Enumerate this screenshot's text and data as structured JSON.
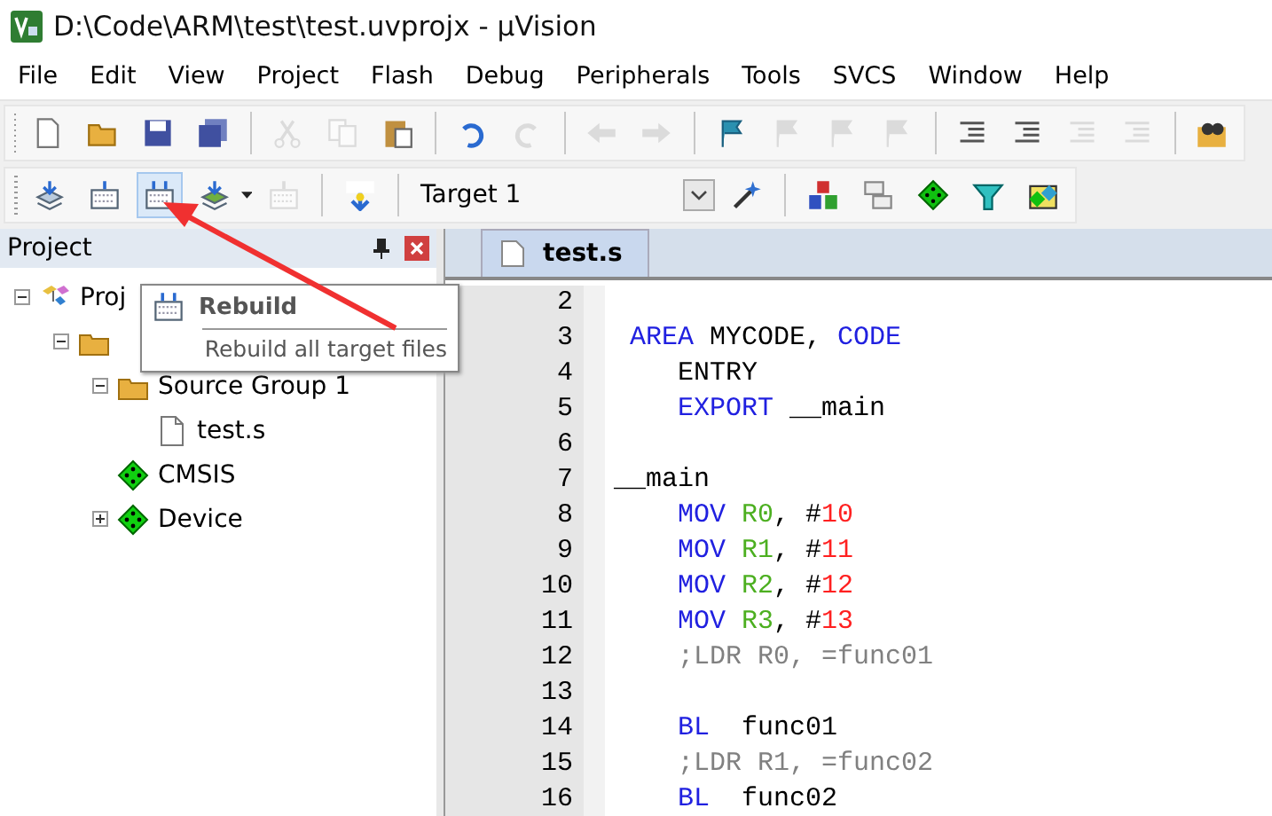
{
  "window": {
    "title": "D:\\Code\\ARM\\test\\test.uvprojx - µVision"
  },
  "menu": [
    "File",
    "Edit",
    "View",
    "Project",
    "Flash",
    "Debug",
    "Peripherals",
    "Tools",
    "SVCS",
    "Window",
    "Help"
  ],
  "toolbar": [
    {
      "kind": "new",
      "disabled": false
    },
    {
      "kind": "open",
      "disabled": false
    },
    {
      "kind": "save",
      "disabled": false
    },
    {
      "kind": "save-all",
      "disabled": false
    },
    {
      "kind": "sep"
    },
    {
      "kind": "cut",
      "disabled": true
    },
    {
      "kind": "copy",
      "disabled": true
    },
    {
      "kind": "paste",
      "disabled": false
    },
    {
      "kind": "sep"
    },
    {
      "kind": "undo",
      "disabled": false
    },
    {
      "kind": "redo",
      "disabled": true
    },
    {
      "kind": "sep"
    },
    {
      "kind": "back",
      "disabled": true
    },
    {
      "kind": "forward",
      "disabled": true
    },
    {
      "kind": "sep"
    },
    {
      "kind": "bookmark",
      "disabled": false
    },
    {
      "kind": "prev-bookmark",
      "disabled": true
    },
    {
      "kind": "next-bookmark",
      "disabled": true
    },
    {
      "kind": "clear-bookmarks",
      "disabled": true
    },
    {
      "kind": "sep"
    },
    {
      "kind": "indent",
      "disabled": false
    },
    {
      "kind": "unindent",
      "disabled": false
    },
    {
      "kind": "comment",
      "disabled": true
    },
    {
      "kind": "uncomment",
      "disabled": true
    },
    {
      "kind": "sep"
    },
    {
      "kind": "find",
      "disabled": false
    }
  ],
  "build_toolbar": {
    "buttons": [
      {
        "kind": "translate",
        "disabled": false,
        "hovered": false
      },
      {
        "kind": "build",
        "disabled": false,
        "hovered": false
      },
      {
        "kind": "rebuild",
        "disabled": false,
        "hovered": true
      },
      {
        "kind": "batch",
        "disabled": false,
        "hovered": false
      },
      {
        "kind": "stop",
        "disabled": true,
        "hovered": false
      },
      {
        "kind": "load",
        "disabled": false,
        "hovered": false
      }
    ],
    "target": "Target 1",
    "tools": [
      {
        "kind": "wand"
      },
      {
        "kind": "components"
      },
      {
        "kind": "environment"
      },
      {
        "kind": "rte"
      },
      {
        "kind": "installer"
      },
      {
        "kind": "packs"
      }
    ]
  },
  "project_panel": {
    "title": "Project",
    "tree": [
      {
        "label": "Proj",
        "kind": "project",
        "expanded": true,
        "children": [
          {
            "kind": "target",
            "expanded": true,
            "children": [
              {
                "label": "Source Group 1",
                "kind": "folder",
                "expanded": true,
                "children": [
                  {
                    "label": "test.s",
                    "kind": "file"
                  }
                ]
              },
              {
                "label": "CMSIS",
                "kind": "component"
              },
              {
                "label": "Device",
                "kind": "component",
                "expanded": false
              }
            ]
          }
        ]
      }
    ]
  },
  "tooltip": {
    "title": "Rebuild",
    "text": "Rebuild all target files"
  },
  "editor": {
    "tab": "test.s",
    "lines": [
      {
        "number": "2"
      },
      {
        "number": "3",
        "tokens": [
          {
            "kind": "keyword",
            "text": " AREA "
          },
          {
            "kind": "plain",
            "text": "MYCODE, "
          },
          {
            "kind": "keyword",
            "text": "CODE"
          }
        ]
      },
      {
        "number": "4",
        "tokens": [
          {
            "kind": "plain",
            "text": "    ENTRY"
          }
        ]
      },
      {
        "number": "5",
        "tokens": [
          {
            "kind": "keyword",
            "text": "    EXPORT "
          },
          {
            "kind": "plain",
            "text": "__main"
          }
        ]
      },
      {
        "number": "6"
      },
      {
        "number": "7",
        "tokens": [
          {
            "kind": "plain",
            "text": "__main"
          }
        ]
      },
      {
        "number": "8",
        "tokens": [
          {
            "kind": "keyword",
            "text": "    MOV "
          },
          {
            "kind": "register",
            "text": "R0"
          },
          {
            "kind": "plain",
            "text": ", #"
          },
          {
            "kind": "number",
            "text": "10"
          }
        ]
      },
      {
        "number": "9",
        "tokens": [
          {
            "kind": "keyword",
            "text": "    MOV "
          },
          {
            "kind": "register",
            "text": "R1"
          },
          {
            "kind": "plain",
            "text": ", #"
          },
          {
            "kind": "number",
            "text": "11"
          }
        ]
      },
      {
        "number": "10",
        "tokens": [
          {
            "kind": "keyword",
            "text": "    MOV "
          },
          {
            "kind": "register",
            "text": "R2"
          },
          {
            "kind": "plain",
            "text": ", #"
          },
          {
            "kind": "number",
            "text": "12"
          }
        ]
      },
      {
        "number": "11",
        "tokens": [
          {
            "kind": "keyword",
            "text": "    MOV "
          },
          {
            "kind": "register",
            "text": "R3"
          },
          {
            "kind": "plain",
            "text": ", #"
          },
          {
            "kind": "number",
            "text": "13"
          }
        ]
      },
      {
        "number": "12",
        "tokens": [
          {
            "kind": "comment",
            "text": "    ;LDR R0, =func01"
          }
        ]
      },
      {
        "number": "13"
      },
      {
        "number": "14",
        "tokens": [
          {
            "kind": "keyword",
            "text": "    BL  "
          },
          {
            "kind": "plain",
            "text": "func01"
          }
        ]
      },
      {
        "number": "15",
        "tokens": [
          {
            "kind": "comment",
            "text": "    ;LDR R1, =func02"
          }
        ]
      },
      {
        "number": "16",
        "tokens": [
          {
            "kind": "keyword",
            "text": "    BL  "
          },
          {
            "kind": "plain",
            "text": "func02"
          }
        ]
      }
    ]
  }
}
